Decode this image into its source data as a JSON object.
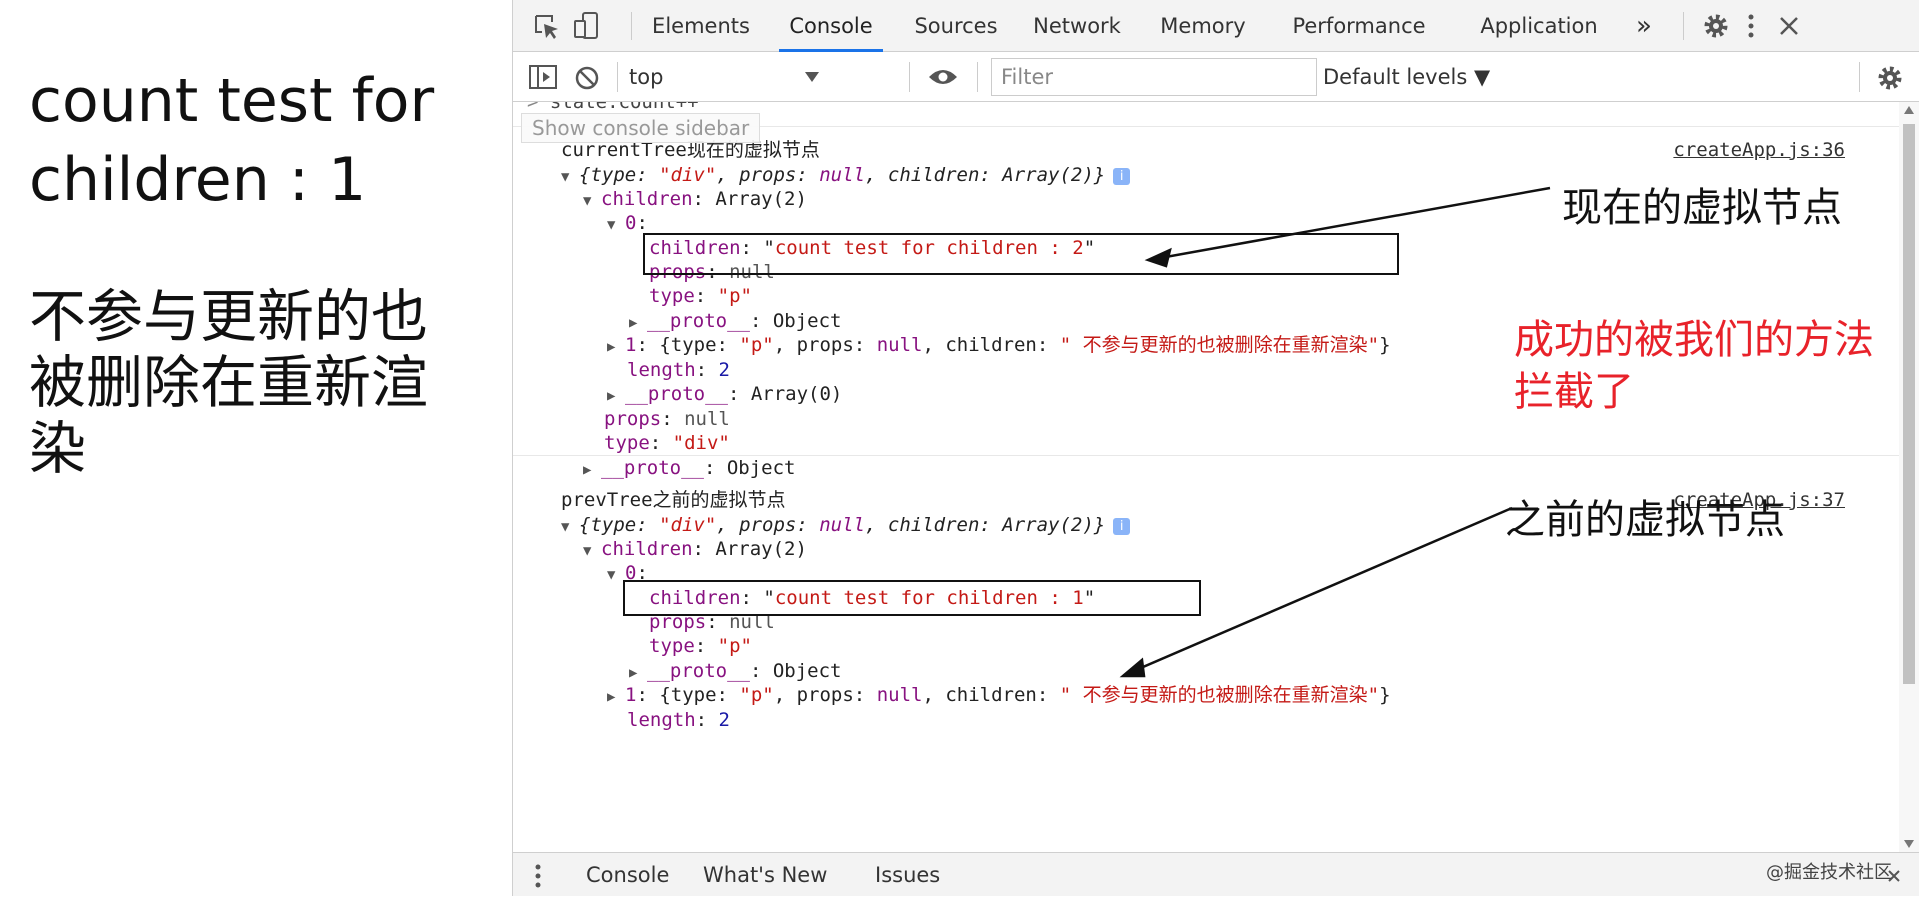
{
  "preview": {
    "line1": "count test for children : 1",
    "line2": "不参与更新的也被删除在重新渲染"
  },
  "devtools": {
    "tabs": [
      "Elements",
      "Console",
      "Sources",
      "Network",
      "Memory",
      "Performance",
      "Application"
    ],
    "more_tabs": "»",
    "active_tab": "Console",
    "context": "top",
    "filter_placeholder": "Filter",
    "levels": "Default levels ▼",
    "tooltip": "Show console sidebar",
    "command": "state.count++",
    "msg1": {
      "label": "currentTree现在的虚拟节点",
      "source": "createApp.js:36",
      "child_text": "count test for children : 2"
    },
    "msg2": {
      "label": "prevTree之前的虚拟节点",
      "source": "createApp.js:37",
      "child_text": "count test for children : 1"
    },
    "drawer_tabs": [
      "Console",
      "What's New",
      "Issues"
    ]
  },
  "annotations": {
    "current": "现在的虚拟节点",
    "intercepted_l1": "成功的被我们的方法",
    "intercepted_l2": "拦截了",
    "previous": "之前的虚拟节点",
    "watermark": "@掘金技术社区"
  },
  "colors": {
    "accent": "#1a73e8",
    "annotation_red": "#e8222a",
    "keyword": "#881280",
    "string": "#c41a16",
    "number": "#1a1aa6"
  }
}
